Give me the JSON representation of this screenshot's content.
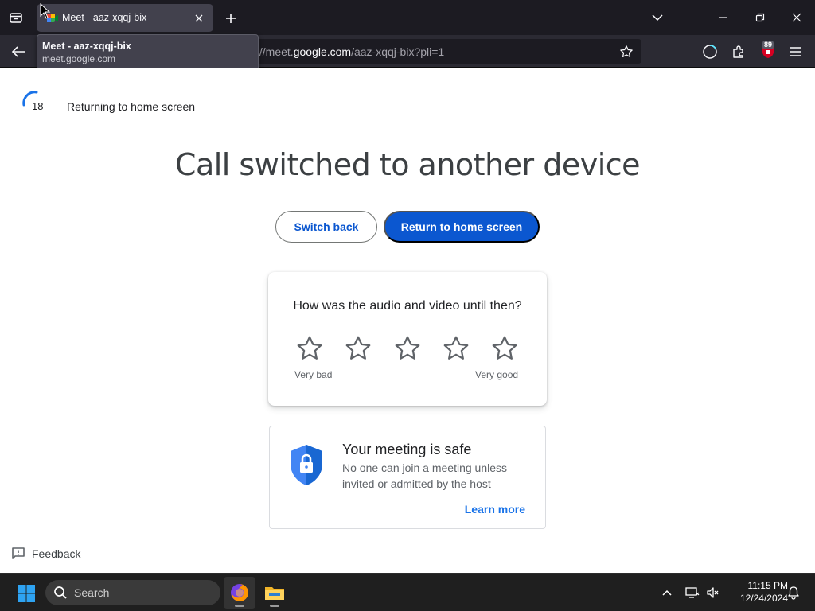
{
  "browser": {
    "tab": {
      "title": "Meet - aaz-xqqj-bix"
    },
    "tooltip": {
      "title": "Meet - aaz-xqqj-bix",
      "url": "meet.google.com"
    },
    "url": {
      "prefix": "://meet.",
      "domain": "google.com",
      "path": "/aaz-xqqj-bix?pli=1"
    },
    "extension_badge": "89",
    "icons": [
      "tab-list-icon",
      "close-icon",
      "plus-icon",
      "chevron-down-icon",
      "minimize-icon",
      "restore-icon",
      "close-window-icon",
      "back-arrow-icon",
      "star-icon",
      "firefox-view-icon",
      "extensions-icon",
      "addon-icon",
      "menu-icon"
    ]
  },
  "page": {
    "countdown": {
      "seconds": "18",
      "label": "Returning to home screen"
    },
    "headline": "Call switched to another device",
    "buttons": {
      "switch_back": "Switch back",
      "return_home": "Return to home screen"
    },
    "rating": {
      "question": "How was the audio and video until then?",
      "star_count": 5,
      "low_label": "Very bad",
      "high_label": "Very good"
    },
    "safety": {
      "title": "Your meeting is safe",
      "description": "No one can join a meeting unless invited or admitted by the host",
      "link": "Learn more"
    },
    "feedback": "Feedback"
  },
  "taskbar": {
    "search_placeholder": "Search",
    "time": "11:15 PM",
    "date": "12/24/2024",
    "apps": [
      "firefox",
      "file-explorer"
    ]
  },
  "colors": {
    "primary": "#0b57d0",
    "link": "#1a73e8",
    "shield": "#4285f4",
    "browser_dark": "#1c1b22",
    "taskbar": "#1f1f1f"
  }
}
